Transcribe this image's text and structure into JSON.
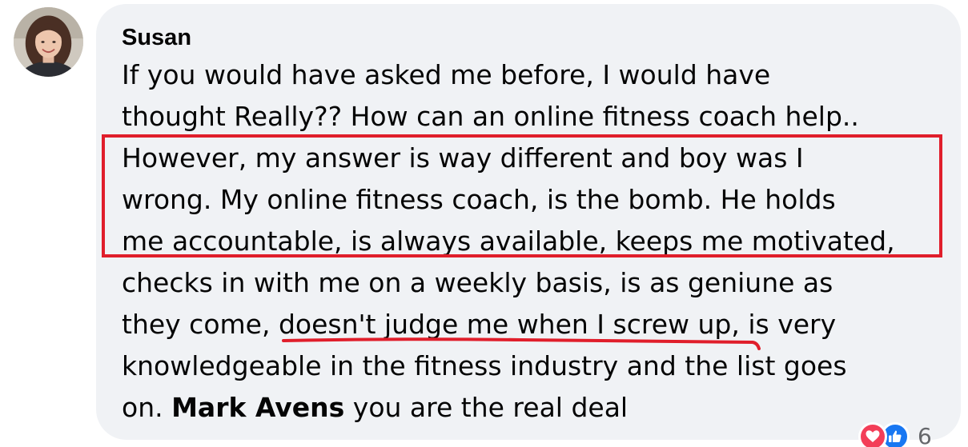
{
  "comment": {
    "author": "Susan",
    "body": {
      "line_1": "If you would have asked me before, I would have",
      "line_2": "thought Really?? How can an online fitness coach help..",
      "line_3": "However, my answer is way different and boy was I",
      "line_4": "wrong. My online fitness coach, is the bomb. He holds",
      "line_5": "me accountable, is always available, keeps me motivated,",
      "line_6": "checks in with me on a weekly basis, is as geniune as",
      "line_7_before": "they come, ",
      "line_7_underlined": "doesn't judge me when I screw up",
      "line_7_after": ", is very",
      "line_8": "knowledgeable in the fitness industry and the list goes",
      "line_9_before": "on. ",
      "mention": "Mark Avens",
      "line_9_after": " you are the real deal"
    },
    "reactions": {
      "icons": [
        "love-icon",
        "like-icon"
      ],
      "count": "6"
    }
  },
  "colors": {
    "bubble": "#f0f2f5",
    "annotation_red": "#e01e2b",
    "love": "#f33e58",
    "like": "#1877f2",
    "meta_text": "#65676b"
  }
}
